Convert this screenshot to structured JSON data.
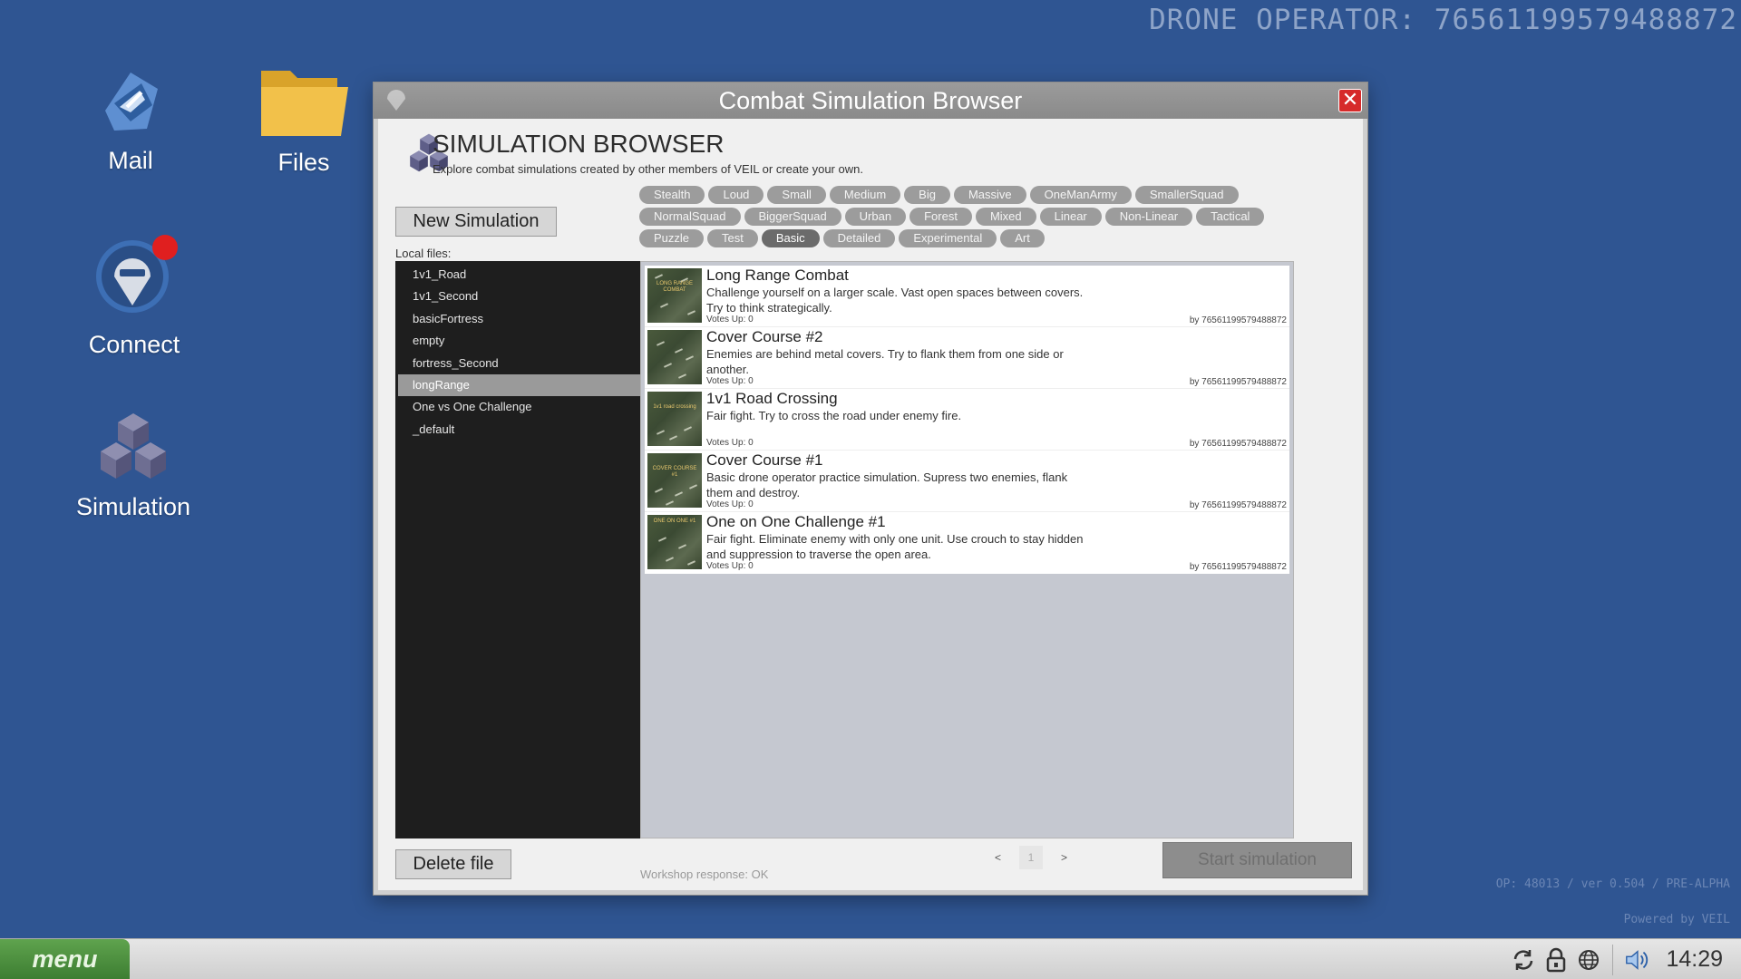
{
  "operator_banner": "DRONE OPERATOR: 76561199579488872",
  "desktop": {
    "icons": [
      {
        "label": "Mail"
      },
      {
        "label": "Files"
      },
      {
        "label": "Connect"
      },
      {
        "label": "Simulation"
      }
    ]
  },
  "window": {
    "title": "Combat Simulation Browser",
    "close_label": "✕",
    "header_title": "SIMULATION BROWSER",
    "header_subtitle": "Explore combat simulations created by other members of VEIL or create your own.",
    "new_simulation_label": "New Simulation",
    "local_files_label": "Local files:",
    "local_files": [
      "1v1_Road",
      "1v1_Second",
      "basicFortress",
      "empty",
      "fortress_Second",
      "longRange",
      "One vs One Challenge",
      "_default"
    ],
    "selected_file_index": 5,
    "tag_rows": [
      [
        "Stealth",
        "Loud",
        "Small",
        "Medium",
        "Big",
        "Massive",
        "OneManArmy",
        "SmallerSquad"
      ],
      [
        "NormalSquad",
        "BiggerSquad",
        "Urban",
        "Forest",
        "Mixed",
        "Linear",
        "Non-Linear",
        "Tactical"
      ],
      [
        "Puzzle",
        "Test",
        "Basic",
        "Detailed",
        "Experimental",
        "Art"
      ]
    ],
    "active_tag": "Basic",
    "results": [
      {
        "title": "Long Range Combat",
        "desc": "Challenge yourself on a larger scale. Vast open spaces between covers. Try to think strategically.",
        "votes": "Votes Up: 0",
        "by": "by 76561199579488872",
        "thumb_text": "LONG RANGE COMBAT"
      },
      {
        "title": "Cover Course #2",
        "desc": "Enemies are behind metal covers. Try to flank them from one side or another.",
        "votes": "Votes Up: 0",
        "by": "by 76561199579488872",
        "thumb_text": ""
      },
      {
        "title": "1v1 Road Crossing",
        "desc": "Fair fight. Try to cross the road under enemy fire.",
        "votes": "Votes Up: 0",
        "by": "by 76561199579488872",
        "thumb_text": "1v1 road crossing"
      },
      {
        "title": "Cover Course #1",
        "desc": "Basic drone operator practice simulation. Supress two enemies, flank them and destroy.",
        "votes": "Votes Up: 0",
        "by": "by 76561199579488872",
        "thumb_text": "COVER COURSE #1"
      },
      {
        "title": "One on One Challenge #1",
        "desc": "Fair fight. Eliminate enemy with only one unit. Use crouch to stay hidden and suppression to traverse the open area.",
        "votes": "Votes Up: 0",
        "by": "by 76561199579488872",
        "thumb_text": "ONE ON ONE #1"
      }
    ],
    "delete_label": "Delete file",
    "workshop_status": "Workshop response: OK",
    "pager": {
      "prev": "<",
      "page": "1",
      "next": ">"
    },
    "start_label": "Start simulation"
  },
  "version_info": "OP: 48013 / ver  0.504 / PRE-ALPHA",
  "powered_by": "Powered by VEIL",
  "taskbar": {
    "menu_label": "menu",
    "clock": "14:29",
    "tray_icons": [
      "sync-icon",
      "lock-icon",
      "globe-icon",
      "volume-icon"
    ]
  },
  "colors": {
    "desktop_bg": "#2f5592",
    "menu_green": "#4e9440",
    "close_red": "#d62a2a",
    "notification_red": "#e01f1f"
  }
}
